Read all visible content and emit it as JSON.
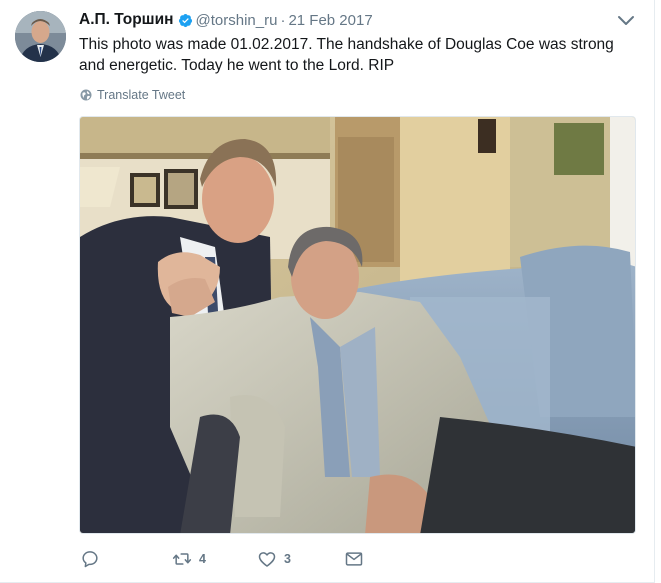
{
  "tweet": {
    "author_name": "А.П. Торшин",
    "handle": "@torshin_ru",
    "date_separator": "·",
    "date": "21 Feb 2017",
    "verified": true,
    "text": "This photo was made 01.02.2017. The handshake of Douglas Coe was strong and energetic. Today he went to the Lord. RIP",
    "translate_label": "Translate Tweet",
    "media_description_icon": "photo",
    "actions": {
      "reply_count": "",
      "retweet_count": "4",
      "like_count": "3"
    }
  },
  "colors": {
    "text_primary": "#14171a",
    "text_secondary": "#657786",
    "verified_blue": "#1da1f2",
    "border": "#e6ecf0"
  },
  "icons": [
    "verified-badge-icon",
    "chevron-down-icon",
    "globe-icon",
    "reply-icon",
    "retweet-icon",
    "like-icon",
    "direct-message-icon"
  ]
}
